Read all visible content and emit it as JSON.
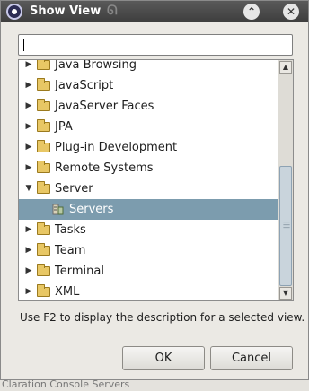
{
  "dialog": {
    "title": "Show View",
    "max_glyph": "⌃",
    "close_glyph": "✕"
  },
  "filter": {
    "value": "",
    "placeholder": ""
  },
  "tree": {
    "items": [
      {
        "label": "Java Browsing",
        "expanded": false,
        "type": "folder"
      },
      {
        "label": "JavaScript",
        "expanded": false,
        "type": "folder"
      },
      {
        "label": "JavaServer Faces",
        "expanded": false,
        "type": "folder"
      },
      {
        "label": "JPA",
        "expanded": false,
        "type": "folder"
      },
      {
        "label": "Plug-in Development",
        "expanded": false,
        "type": "folder"
      },
      {
        "label": "Remote Systems",
        "expanded": false,
        "type": "folder"
      },
      {
        "label": "Server",
        "expanded": true,
        "type": "folder"
      },
      {
        "label": "Servers",
        "type": "view",
        "selected": true
      },
      {
        "label": "Tasks",
        "expanded": false,
        "type": "folder"
      },
      {
        "label": "Team",
        "expanded": false,
        "type": "folder"
      },
      {
        "label": "Terminal",
        "expanded": false,
        "type": "folder"
      },
      {
        "label": "XML",
        "expanded": false,
        "type": "folder"
      }
    ]
  },
  "description": "Use F2 to display the description for a selected view.",
  "buttons": {
    "ok": "OK",
    "cancel": "Cancel"
  },
  "background_tabs": "Claration  Console  Servers",
  "colors": {
    "selection": "#7c9cae",
    "folder": "#e8c765",
    "titlebar": "#3d3d3d"
  }
}
